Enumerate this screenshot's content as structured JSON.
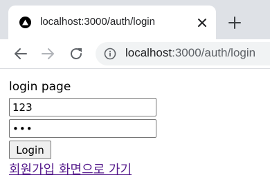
{
  "browser": {
    "tab": {
      "title": "localhost:3000/auth/login",
      "favicon": "triangle-logo-icon",
      "close_icon": "close-icon"
    },
    "new_tab_icon": "plus-icon",
    "toolbar": {
      "back_icon": "arrow-left-icon",
      "forward_icon": "arrow-right-icon",
      "reload_icon": "reload-icon",
      "info_icon": "info-icon",
      "url_host": "localhost",
      "url_path": ":3000/auth/login"
    }
  },
  "page": {
    "heading": "login page",
    "id_input": {
      "value": "123"
    },
    "password_input": {
      "value": "•••"
    },
    "login_button_label": "Login",
    "signup_link_label": "회원가입 화면으로 가기"
  },
  "colors": {
    "tabstrip_bg": "#dee1e6",
    "omnibox_bg": "#f1f3f4",
    "visited_link": "#551a8b"
  }
}
